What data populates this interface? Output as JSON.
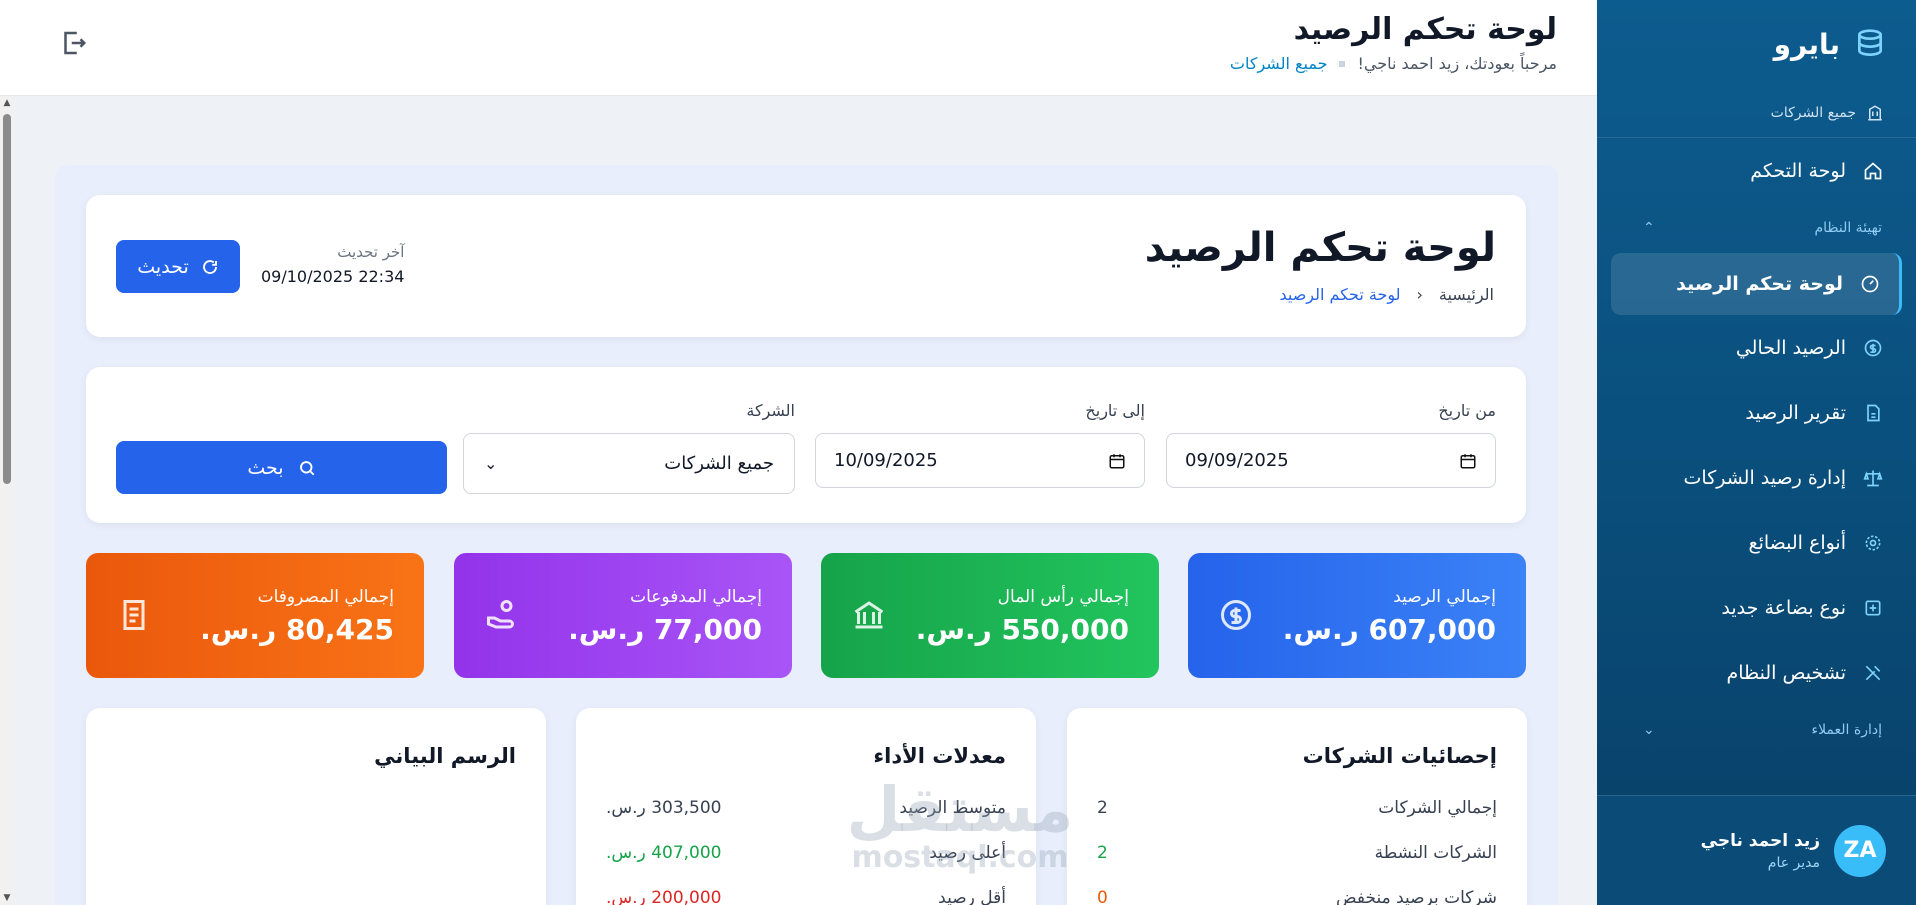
{
  "brand": {
    "name": "بايرو"
  },
  "sidebar": {
    "all_companies": "جميع الشركات",
    "items": [
      {
        "label": "لوحة التحكم"
      },
      {
        "label": "لوحة تحكم الرصيد"
      },
      {
        "label": "الرصيد الحالي"
      },
      {
        "label": "تقرير الرصيد"
      },
      {
        "label": "إدارة رصيد الشركات"
      },
      {
        "label": "أنواع البضائع"
      },
      {
        "label": "نوع بضاعة جديد"
      },
      {
        "label": "تشخيص النظام"
      }
    ],
    "section_system": "تهيئة النظام",
    "section_clients": "إدارة العملاء",
    "user": {
      "name": "زيد احمد ناجي",
      "role": "مدير عام",
      "initials": "ZA"
    }
  },
  "topbar": {
    "title": "لوحة تحكم الرصيد",
    "welcome": "مرحباً بعودتك، زيد احمد ناجي!",
    "company_link": "جميع الشركات"
  },
  "header": {
    "title": "لوحة تحكم الرصيد",
    "breadcrumb_home": "الرئيسية",
    "breadcrumb_current": "لوحة تحكم الرصيد",
    "last_update_label": "آخر تحديث",
    "last_update_value": "22:34 09/10/2025",
    "refresh_label": "تحديث"
  },
  "filters": {
    "from_label": "من تاريخ",
    "from_value": "09/09/2025",
    "to_label": "إلى تاريخ",
    "to_value": "10/09/2025",
    "company_label": "الشركة",
    "company_value": "جميع الشركات",
    "search_label": "بحث"
  },
  "stats": {
    "balance": {
      "label": "إجمالي الرصيد",
      "value": "607,000 ر.س."
    },
    "capital": {
      "label": "إجمالي رأس المال",
      "value": "550,000 ر.س."
    },
    "payments": {
      "label": "إجمالي المدفوعات",
      "value": "77,000 ر.س."
    },
    "expenses": {
      "label": "إجمالي المصروفات",
      "value": "80,425 ر.س."
    }
  },
  "company_stats": {
    "title": "إحصائيات الشركات",
    "rows": [
      {
        "label": "إجمالي الشركات",
        "value": "2"
      },
      {
        "label": "الشركات النشطة",
        "value": "2"
      },
      {
        "label": "شركات برصيد منخفض",
        "value": "0"
      }
    ]
  },
  "performance": {
    "title": "معدلات الأداء",
    "rows": [
      {
        "label": "متوسط الرصيد",
        "value": "303,500 ر.س."
      },
      {
        "label": "أعلى رصيد",
        "value": "407,000 ر.س."
      },
      {
        "label": "أقل رصيد",
        "value": "200,000 ر.س."
      }
    ]
  },
  "chart_card": {
    "title": "الرسم البياني"
  },
  "watermark": {
    "big": "مستقل",
    "small": "mostaql.com"
  }
}
